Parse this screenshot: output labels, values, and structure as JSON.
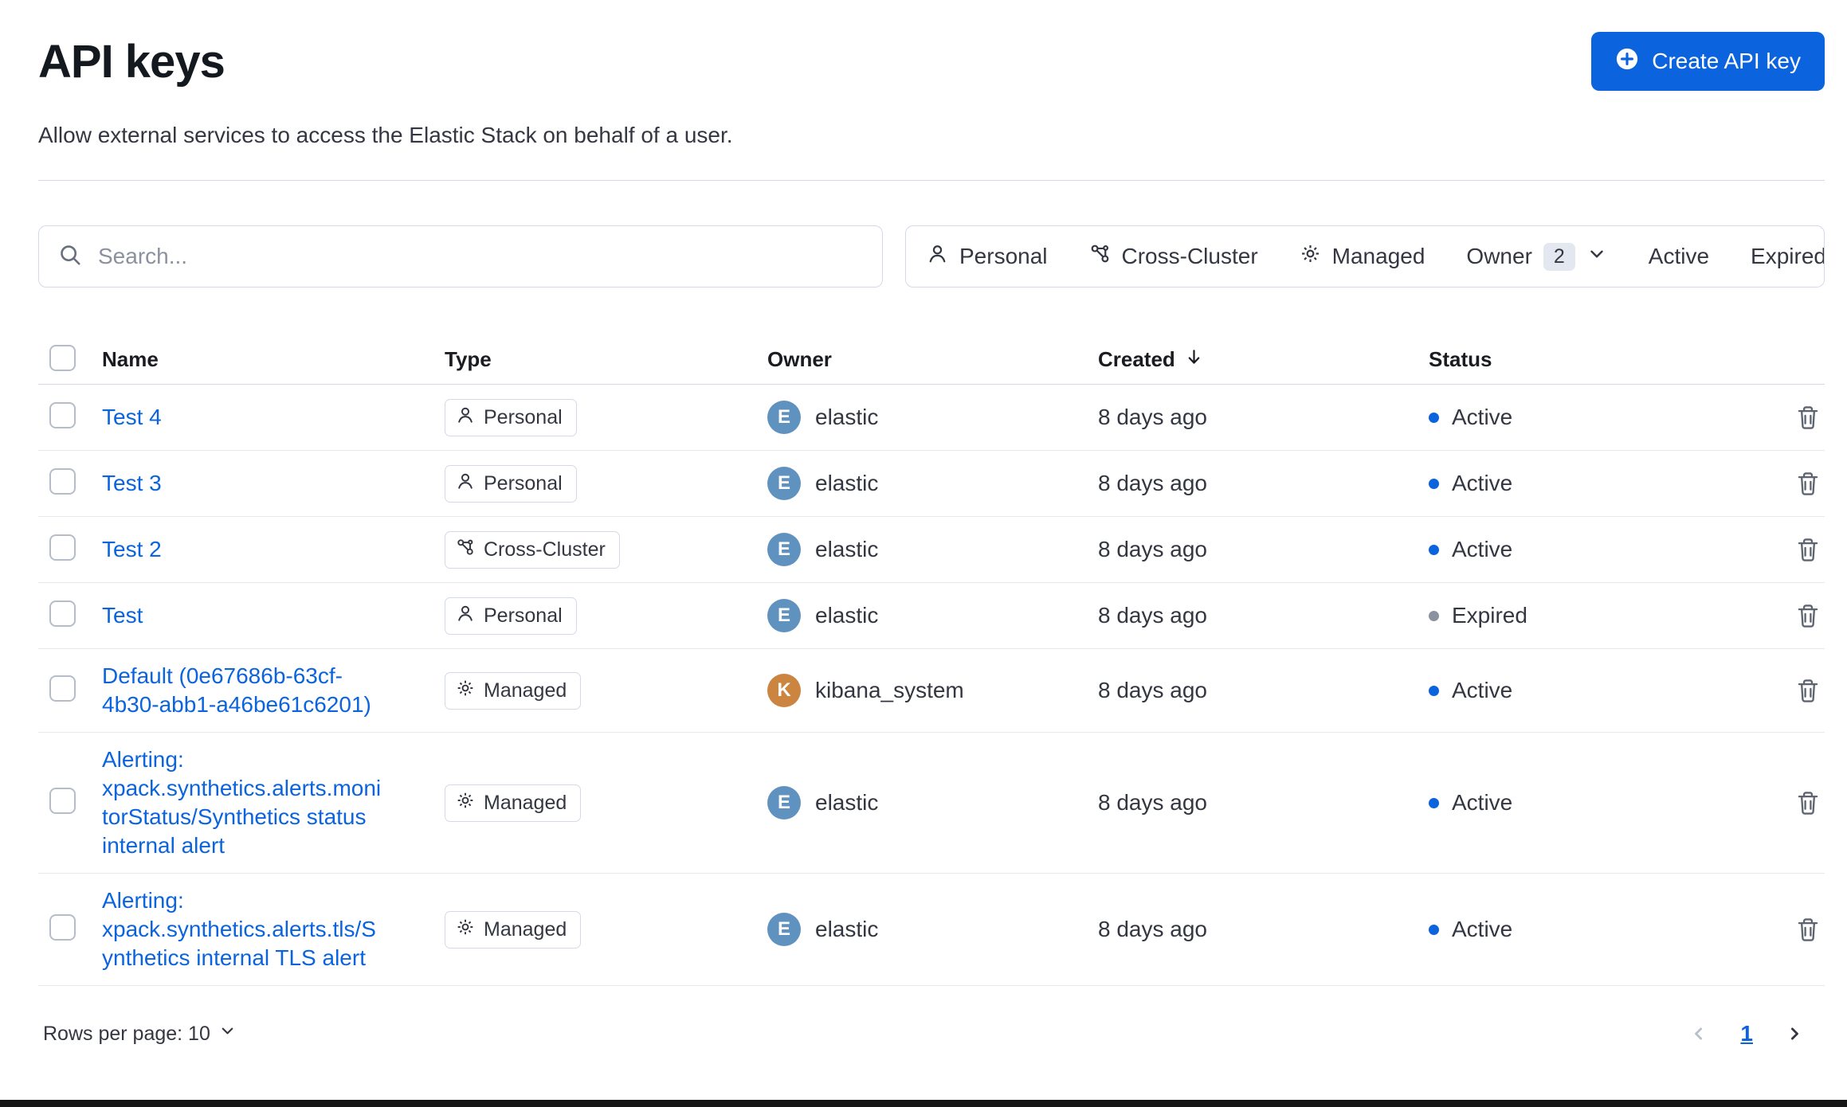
{
  "colors": {
    "primary": "#0b64dd",
    "link": "#0b64dd",
    "status_dots": {
      "Active": "#0b64dd",
      "Expired": "#8a92a0"
    },
    "avatar_elastic": "#6092c0",
    "avatar_kibana_system": "#cc8441",
    "border": "#d3dae6"
  },
  "page": {
    "title": "API keys",
    "subtitle": "Allow external services to access the Elastic Stack on behalf of a user.",
    "create_button_label": "Create API key"
  },
  "toolbar": {
    "search_placeholder": "Search...",
    "filter_personal": "Personal",
    "filter_cross_cluster": "Cross-Cluster",
    "filter_managed": "Managed",
    "filter_owner": "Owner",
    "owner_count": "2",
    "filter_active": "Active",
    "filter_expired": "Expired"
  },
  "table": {
    "headers": {
      "name": "Name",
      "type": "Type",
      "owner": "Owner",
      "created": "Created",
      "status": "Status"
    },
    "sorted_by": "Created",
    "rows": [
      {
        "name": "Test 4",
        "type": "Personal",
        "type_icon": "person-icon",
        "owner": "elastic",
        "avatar_initial": "E",
        "avatar_color": "#6092c0",
        "created": "8 days ago",
        "status": "Active"
      },
      {
        "name": "Test 3",
        "type": "Personal",
        "type_icon": "person-icon",
        "owner": "elastic",
        "avatar_initial": "E",
        "avatar_color": "#6092c0",
        "created": "8 days ago",
        "status": "Active"
      },
      {
        "name": "Test 2",
        "type": "Cross-Cluster",
        "type_icon": "cluster-icon",
        "owner": "elastic",
        "avatar_initial": "E",
        "avatar_color": "#6092c0",
        "created": "8 days ago",
        "status": "Active"
      },
      {
        "name": "Test",
        "type": "Personal",
        "type_icon": "person-icon",
        "owner": "elastic",
        "avatar_initial": "E",
        "avatar_color": "#6092c0",
        "created": "8 days ago",
        "status": "Expired"
      },
      {
        "name": "Default (0e67686b-63cf-4b30-abb1-a46be61c6201)",
        "type": "Managed",
        "type_icon": "gear-icon",
        "owner": "kibana_system",
        "avatar_initial": "K",
        "avatar_color": "#cc8441",
        "created": "8 days ago",
        "status": "Active"
      },
      {
        "name": "Alerting: xpack.synthetics.alerts.monitorStatus/Synthetics status internal alert",
        "type": "Managed",
        "type_icon": "gear-icon",
        "owner": "elastic",
        "avatar_initial": "E",
        "avatar_color": "#6092c0",
        "created": "8 days ago",
        "status": "Active"
      },
      {
        "name": "Alerting: xpack.synthetics.alerts.tls/Synthetics internal TLS alert",
        "type": "Managed",
        "type_icon": "gear-icon",
        "owner": "elastic",
        "avatar_initial": "E",
        "avatar_color": "#6092c0",
        "created": "8 days ago",
        "status": "Active"
      }
    ]
  },
  "pagination": {
    "rows_per_page": "Rows per page: 10",
    "current_page": "1"
  }
}
